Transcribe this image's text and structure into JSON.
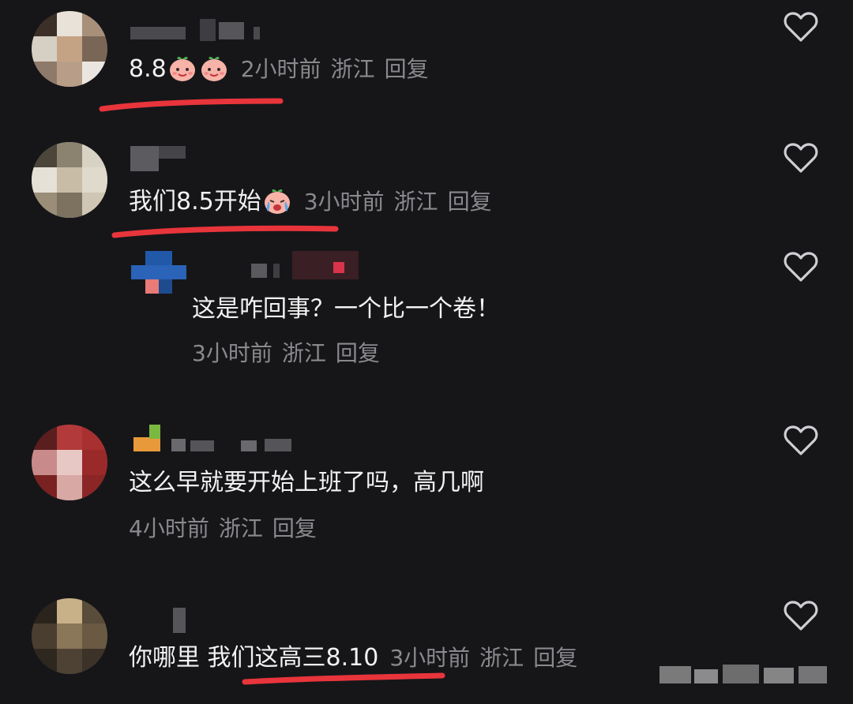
{
  "comments": [
    {
      "body": "8.8",
      "emojis": [
        "smiling-peach-emoji",
        "smiling-peach-emoji"
      ],
      "time": "2小时前",
      "location": "浙江",
      "reply_label": "回复"
    },
    {
      "body": "我们8.5开始",
      "emojis": [
        "crying-emoji"
      ],
      "time": "3小时前",
      "location": "浙江",
      "reply_label": "回复"
    },
    {
      "body": "这是咋回事？一个比一个卷！",
      "time": "3小时前",
      "location": "浙江",
      "reply_label": "回复"
    },
    {
      "body": "这么早就要开始上班了吗，高几啊",
      "time": "4小时前",
      "location": "浙江",
      "reply_label": "回复"
    },
    {
      "body_part1": "你哪里",
      "body_part2": "我们这高三",
      "body_part3": "8.10",
      "time": "3小时前",
      "location": "浙江",
      "reply_label": "回复"
    }
  ],
  "colors": {
    "background": "#161619",
    "text": "#f2f2f2",
    "meta": "#8a8a8e",
    "underline": "#e8353b",
    "heart": "#cfcfd3"
  },
  "icons": {
    "like": "heart-outline-icon"
  }
}
